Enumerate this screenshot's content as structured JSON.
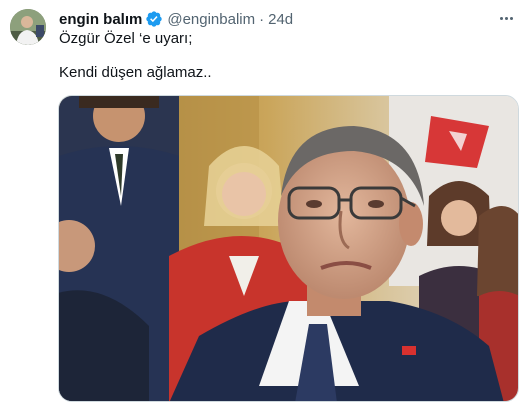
{
  "post": {
    "display_name": "engin balım",
    "handle": "@enginbalim",
    "separator": "·",
    "time": "24d",
    "text_line_1": "Özgür Özel ‘e uyarı;",
    "text_line_2": "Kendi düşen ağlamaz.."
  },
  "icons": {
    "verified": "verified-badge-icon",
    "more": "more-options-icon"
  },
  "colors": {
    "verified_blue": "#1d9bf0",
    "secondary_text": "#536471",
    "primary_text": "#0f1419",
    "border": "#cfd9de"
  }
}
